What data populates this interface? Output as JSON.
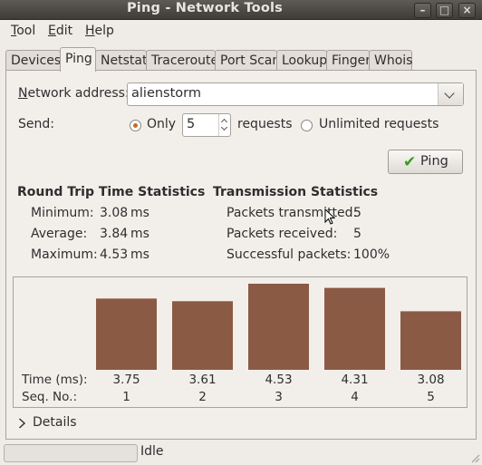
{
  "window": {
    "title": "Ping - Network Tools"
  },
  "menu": [
    {
      "mnemonic": "T",
      "rest": "ool"
    },
    {
      "mnemonic": "E",
      "rest": "dit"
    },
    {
      "mnemonic": "H",
      "rest": "elp"
    }
  ],
  "tabs": [
    "Devices",
    "Ping",
    "Netstat",
    "Traceroute",
    "Port Scan",
    "Lookup",
    "Finger",
    "Whois"
  ],
  "active_tab": "Ping",
  "form": {
    "address_label_mnemonic": "N",
    "address_label_rest": "etwork address:",
    "address_value": "alienstorm",
    "send_label": "Send:",
    "only_label": "Only",
    "count_value": "5",
    "requests_label": "requests",
    "unlimited_label": "Unlimited requests",
    "selected_mode": "Only"
  },
  "ping_button": "Ping",
  "rtt": {
    "heading": "Round Trip Time Statistics",
    "min_label": "Minimum:",
    "min_value": "3.08",
    "min_unit": "ms",
    "avg_label": "Average:",
    "avg_value": "3.84",
    "avg_unit": "ms",
    "max_label": "Maximum:",
    "max_value": "4.53",
    "max_unit": "ms"
  },
  "tx": {
    "heading": "Transmission Statistics",
    "sent_label": "Packets transmitted:",
    "sent_value": "5",
    "recv_label": "Packets received:",
    "recv_value": "5",
    "ok_label": "Successful packets:",
    "ok_value": "100%"
  },
  "chart_data": {
    "type": "bar",
    "row_labels": [
      "Time (ms):",
      "Seq. No.:"
    ],
    "categories": [
      "1",
      "2",
      "3",
      "4",
      "5"
    ],
    "values": [
      3.75,
      3.61,
      4.53,
      4.31,
      3.08
    ],
    "bar_color": "#8b5a45"
  },
  "details": {
    "label": "Details",
    "expanded": false
  },
  "status": {
    "text": "Idle"
  }
}
